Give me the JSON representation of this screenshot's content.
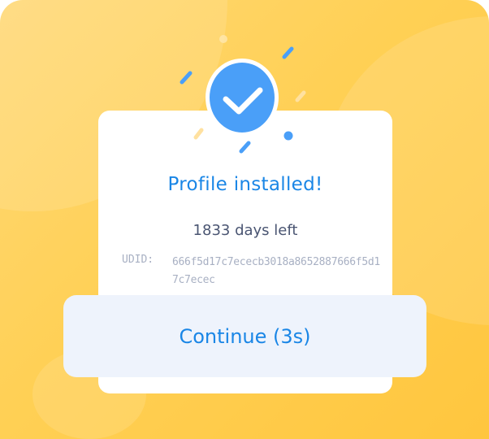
{
  "status": {
    "title": "Profile installed!",
    "days_left": "1833 days left",
    "udid_label": "UDID:",
    "udid_value": "666f5d17c7ececb3018a8652887666f5d17c7ecec",
    "icon": "checkmark-circle-icon"
  },
  "actions": {
    "continue_label": "Continue (3s)"
  },
  "colors": {
    "background": "#FFD055",
    "accent": "#1A86E6",
    "check_circle": "#4A9FF8",
    "button_bg": "#EEF3FC"
  }
}
